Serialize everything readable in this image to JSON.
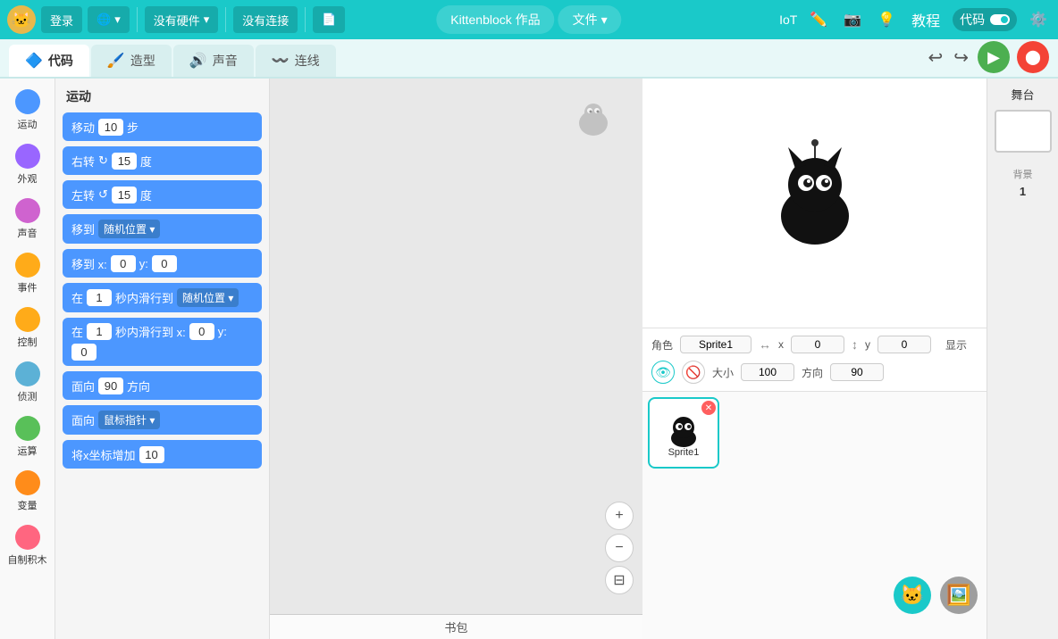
{
  "header": {
    "logo": "🐱",
    "login_label": "登录",
    "language_label": "🌐",
    "hardware_label": "没有硬件",
    "connection_label": "没有连接",
    "file_icon": "📄",
    "center_label": "Kittenblock 作品",
    "file_menu": "文件",
    "iot_label": "IoT",
    "edit_icon": "✏️",
    "camera_icon": "📷",
    "bulb_icon": "💡",
    "tutorial_label": "教程",
    "code_label": "代码",
    "settings_icon": "⚙️"
  },
  "tabs": [
    {
      "id": "code",
      "label": "代码",
      "icon": "🔷",
      "active": true
    },
    {
      "id": "costume",
      "label": "造型",
      "icon": "🖌️",
      "active": false
    },
    {
      "id": "sound",
      "label": "声音",
      "icon": "🔊",
      "active": false
    },
    {
      "id": "connect",
      "label": "连线",
      "icon": "〰️",
      "active": false
    }
  ],
  "categories": [
    {
      "id": "motion",
      "label": "运动",
      "color": "#4c97ff"
    },
    {
      "id": "looks",
      "label": "外观",
      "color": "#9966ff"
    },
    {
      "id": "sound",
      "label": "声音",
      "color": "#cf63cf"
    },
    {
      "id": "events",
      "label": "事件",
      "color": "#ffab19"
    },
    {
      "id": "control",
      "label": "控制",
      "color": "#ffab19"
    },
    {
      "id": "sensing",
      "label": "侦测",
      "color": "#5cb1d6"
    },
    {
      "id": "operators",
      "label": "运算",
      "color": "#59c059"
    },
    {
      "id": "variables",
      "label": "变量",
      "color": "#ff8c1a"
    },
    {
      "id": "custom",
      "label": "自制积木",
      "color": "#ff6680"
    }
  ],
  "blocks_title": "运动",
  "blocks": [
    {
      "id": "move",
      "text": "移动",
      "value": "10",
      "suffix": "步"
    },
    {
      "id": "turn_right",
      "text": "右转",
      "value": "15",
      "suffix": "度",
      "icon": "↻"
    },
    {
      "id": "turn_left",
      "text": "左转",
      "value": "15",
      "suffix": "度",
      "icon": "↺"
    },
    {
      "id": "goto",
      "text": "移到",
      "dropdown": "随机位置"
    },
    {
      "id": "goto_xy",
      "text": "移到 x:",
      "x": "0",
      "y": "0"
    },
    {
      "id": "glide",
      "text": "在",
      "value": "1",
      "suffix": "秒内滑行到",
      "dropdown": "随机位置"
    },
    {
      "id": "glide_xy",
      "text": "在",
      "value": "1",
      "suffix": "秒内滑行到 x:",
      "x": "0",
      "y": "0"
    },
    {
      "id": "face",
      "text": "面向",
      "value": "90",
      "suffix": "方向"
    },
    {
      "id": "face_mouse",
      "text": "面向",
      "dropdown": "鼠标指针"
    },
    {
      "id": "add_x",
      "text": "将x坐标增加",
      "value": "10"
    }
  ],
  "bookbag_label": "书包",
  "stage": {
    "sprite_label": "角色",
    "sprite_name": "Sprite1",
    "x_label": "x",
    "x_value": "0",
    "y_label": "y",
    "y_value": "0",
    "size_label": "大小",
    "size_value": "100",
    "direction_label": "方向",
    "direction_value": "90",
    "show_label": "显示"
  },
  "sprites": [
    {
      "id": "sprite1",
      "name": "Sprite1",
      "selected": true
    }
  ],
  "right_panel": {
    "stage_label": "舞台",
    "bg_label": "背景",
    "bg_count": "1"
  },
  "zoom": {
    "in": "+",
    "out": "−",
    "fit": "⊟"
  }
}
